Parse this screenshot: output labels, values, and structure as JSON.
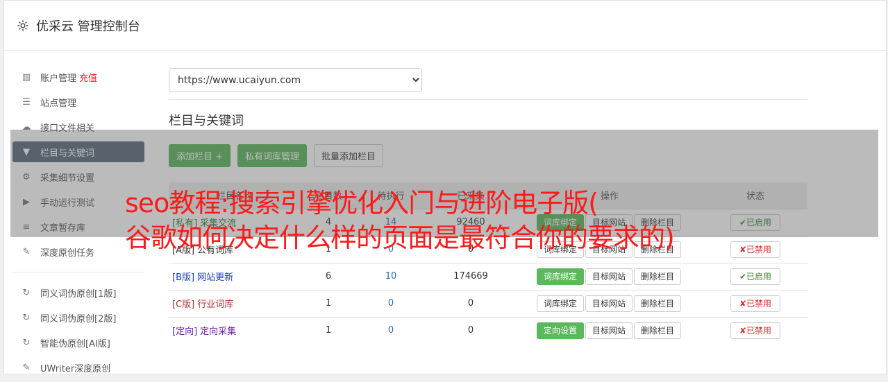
{
  "header": {
    "title": "优采云 管理控制台",
    "icon": "gear-icon"
  },
  "sidebar": {
    "items": [
      {
        "label": "账户管理",
        "extra": "充值",
        "icon": "bar-chart-icon"
      },
      {
        "label": "站点管理",
        "icon": "server-icon"
      },
      {
        "label": "接口文件相关",
        "icon": "cloud-upload-icon"
      },
      {
        "label": "栏目与关键词",
        "icon": "filter-icon",
        "active": true
      },
      {
        "label": "采集细节设置",
        "icon": "cogs-icon"
      },
      {
        "label": "手动运行测试",
        "icon": "play-circle-icon"
      },
      {
        "label": "文章暂存库",
        "icon": "database-icon"
      },
      {
        "label": "深度原创任务",
        "icon": "edit-icon"
      },
      {
        "label": "同义词伪原创[1版]",
        "icon": "refresh-icon"
      },
      {
        "label": "同义词伪原创[2版]",
        "icon": "refresh-icon"
      },
      {
        "label": "智能伪原创[AI版]",
        "icon": "refresh-icon"
      },
      {
        "label": "UWriter深度原创",
        "icon": "edit-icon"
      }
    ]
  },
  "site_select": {
    "value": "https://www.ucaiyun.com"
  },
  "section": {
    "title": "栏目与关键词"
  },
  "buttons": {
    "add": "添加栏目 +",
    "private": "私有词库管理",
    "batch": "批量添加栏目"
  },
  "table": {
    "headers": [
      "栏目名称",
      "栏目数",
      "待执行",
      "已采集",
      "操作",
      "状态"
    ],
    "rows": [
      {
        "tag": "[私有]",
        "name": "采集交流",
        "c1": "4",
        "c2": "14",
        "c3": "92460",
        "b1": "词库绑定",
        "b2": "目标网站",
        "b3": "删除栏目",
        "status": "✔已启用",
        "color": "#2e7d32",
        "b1green": true,
        "on": true
      },
      {
        "tag": "[A版]",
        "name": "公有词库",
        "c1": "1",
        "c2": "0",
        "c3": "0",
        "b1": "词库绑定",
        "b2": "目标网站",
        "b3": "删除栏目",
        "status": "✘已禁用",
        "color": "#333333",
        "b1green": false,
        "on": false
      },
      {
        "tag": "[B版]",
        "name": "网站更新",
        "c1": "6",
        "c2": "10",
        "c3": "174669",
        "b1": "词库绑定",
        "b2": "目标网站",
        "b3": "删除栏目",
        "status": "✔已启用",
        "color": "#1a3fb8",
        "b1green": true,
        "on": true
      },
      {
        "tag": "[C版]",
        "name": "行业词库",
        "c1": "1",
        "c2": "0",
        "c3": "0",
        "b1": "词库绑定",
        "b2": "目标网站",
        "b3": "删除栏目",
        "status": "✘已禁用",
        "color": "#b03030",
        "b1green": false,
        "on": false
      },
      {
        "tag": "[定向]",
        "name": "定向采集",
        "c1": "1",
        "c2": "0",
        "c3": "0",
        "b1": "定向设置",
        "b2": "目标网站",
        "b3": "删除栏目",
        "status": "✘已禁用",
        "color": "#6a1fa8",
        "b1green": true,
        "on": false
      }
    ]
  },
  "banner": {
    "line1": "seo教程:搜索引擎优化入门与进阶电子版(",
    "line2": "谷歌如何决定什么样的页面是最符合你的要求的)"
  }
}
